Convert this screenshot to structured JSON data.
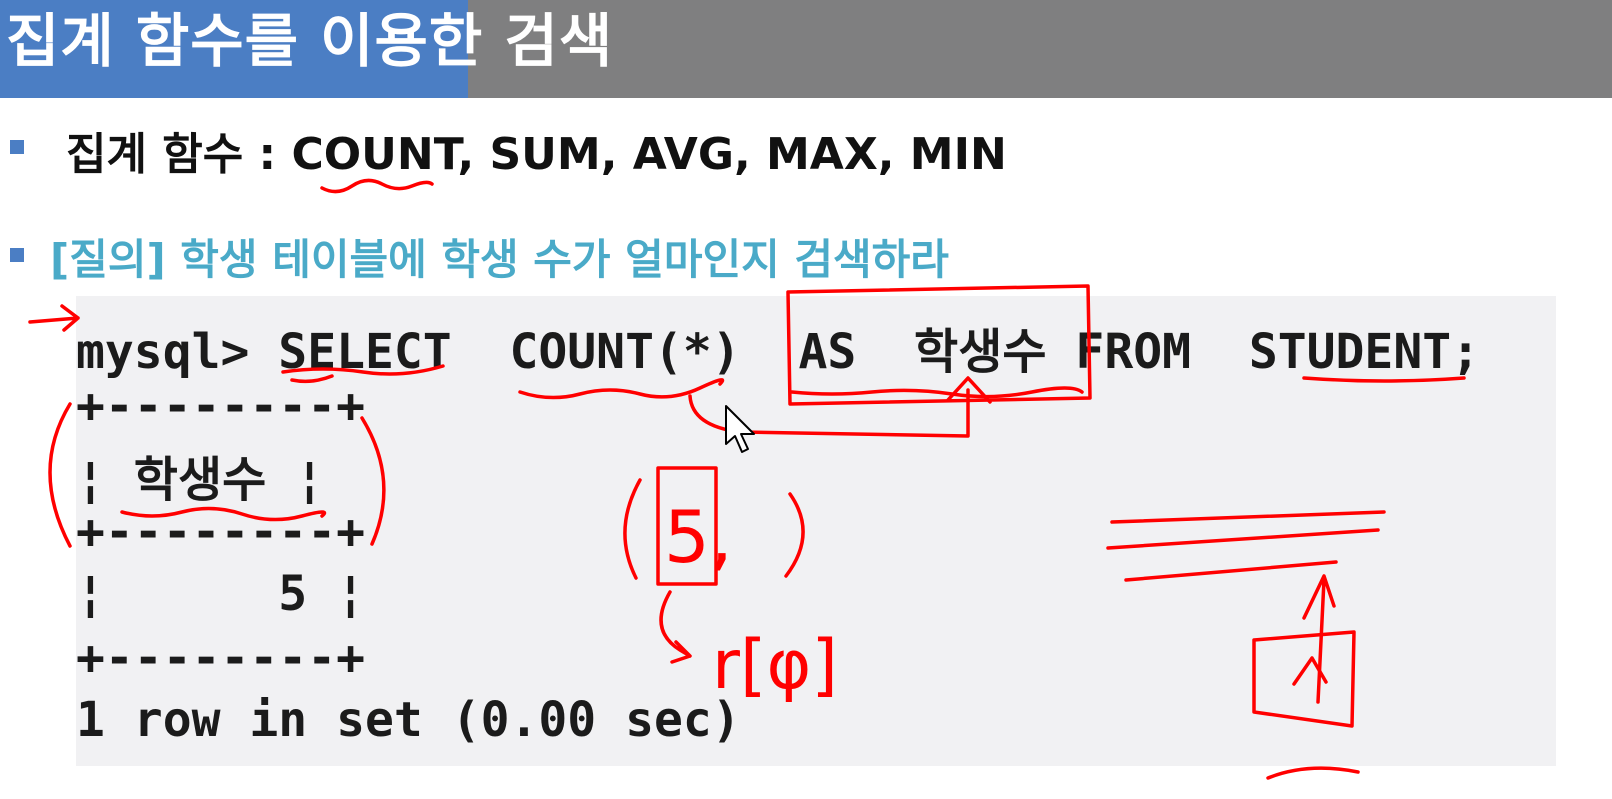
{
  "slide": {
    "title": "집계 함수를 이용한 검색",
    "bullet1": "집계 함수 : COUNT, SUM, AVG, MAX, MIN",
    "bullet2": "[질의] 학생 테이블에 학생 수가 얼마인지 검색하라"
  },
  "console": {
    "lines": [
      "mysql> SELECT  COUNT(*)  AS  학생수 FROM  STUDENT;",
      "+--------+",
      "¦ 학생수 ¦",
      "+--------+",
      "¦      5 ¦",
      "+--------+",
      "1 row in set (0.00 sec)"
    ]
  },
  "annotations": {
    "handwriting_1": "5,",
    "handwriting_2": "r[φ]"
  },
  "colors": {
    "title_accent": "#4b7ec4",
    "title_bar": "#7f7f80",
    "bullet_square": "#4b7ec4",
    "query_text": "#4aaac8",
    "console_bg": "#f1f1f3",
    "ink": "#ff0000"
  }
}
